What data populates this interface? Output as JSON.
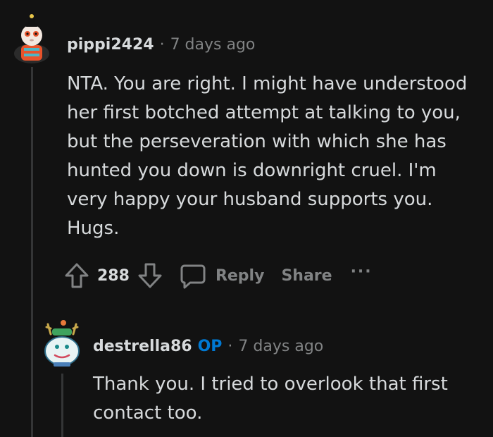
{
  "comment": {
    "username": "pippi2424",
    "separator": "·",
    "time": "7 days ago",
    "avatar": "snoo-avatar-icon",
    "body": [
      "NTA. You are right. I might have understood",
      "her first botched attempt at talking to you,",
      "but the perseveration with which she has",
      "hunted you down is downright cruel. I'm",
      "very happy your husband supports you.",
      "Hugs."
    ],
    "actions": {
      "upvote_icon": "upvote-arrow-icon",
      "score": "288",
      "downvote_icon": "downvote-arrow-icon",
      "comment_icon": "speech-bubble-icon",
      "reply_label": "Reply",
      "share_label": "Share",
      "more_label": "···"
    }
  },
  "reply": {
    "username": "destrella86",
    "badge": "OP",
    "separator": "·",
    "time": "7 days ago",
    "avatar": "snoo-avatar-icon",
    "body": "Thank you. I tried to overlook that first contact too."
  },
  "colors": {
    "background": "#121212",
    "text": "#d7dadc",
    "muted": "#818384",
    "op_badge": "#0079d3",
    "thread_line": "#343536"
  }
}
